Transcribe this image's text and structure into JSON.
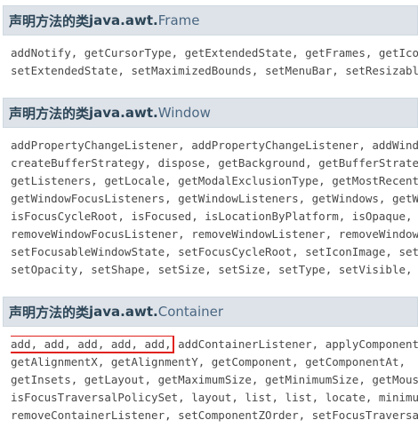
{
  "sections": [
    {
      "prefix": "声明方法的类 ",
      "pkg": "java.awt.",
      "cls": "Frame",
      "lines": [
        "addNotify, getCursorType, getExtendedState, getFrames, getIconImage,",
        "setExtendedState, setMaximizedBounds, setMenuBar, setResizable,"
      ]
    },
    {
      "prefix": "声明方法的类 ",
      "pkg": "java.awt.",
      "cls": "Window",
      "lines": [
        "addPropertyChangeListener, addPropertyChangeListener, addWindowFocusListener,",
        "createBufferStrategy, dispose, getBackground, getBufferStrategy,",
        "getListeners, getLocale, getModalExclusionType, getMostRecentFocusOwner,",
        "getWindowFocusListeners, getWindowListeners, getWindows, getWindowStateListeners,",
        "isFocusCycleRoot, isFocused, isLocationByPlatform, isOpaque,",
        "removeWindowFocusListener, removeWindowListener, removeWindowStateListener,",
        "setFocusableWindowState, setFocusCycleRoot, setIconImage, setIconImages,",
        "setOpacity, setShape, setSize, setSize, setType, setVisible,"
      ]
    },
    {
      "prefix": "声明方法的类 ",
      "pkg": "java.awt.",
      "cls": "Container",
      "highlight": "add, add, add, add, add,",
      "first_rest": " addContainerListener, applyComponentOrientation,",
      "lines": [
        "getAlignmentX, getAlignmentY, getComponent, getComponentAt,",
        "getInsets, getLayout, getMaximumSize, getMinimumSize, getMousePosition,",
        "isFocusTraversalPolicySet, layout, list, list, locate, minimumSize,",
        "removeContainerListener, setComponentZOrder, setFocusTraversalKeys,"
      ]
    }
  ]
}
